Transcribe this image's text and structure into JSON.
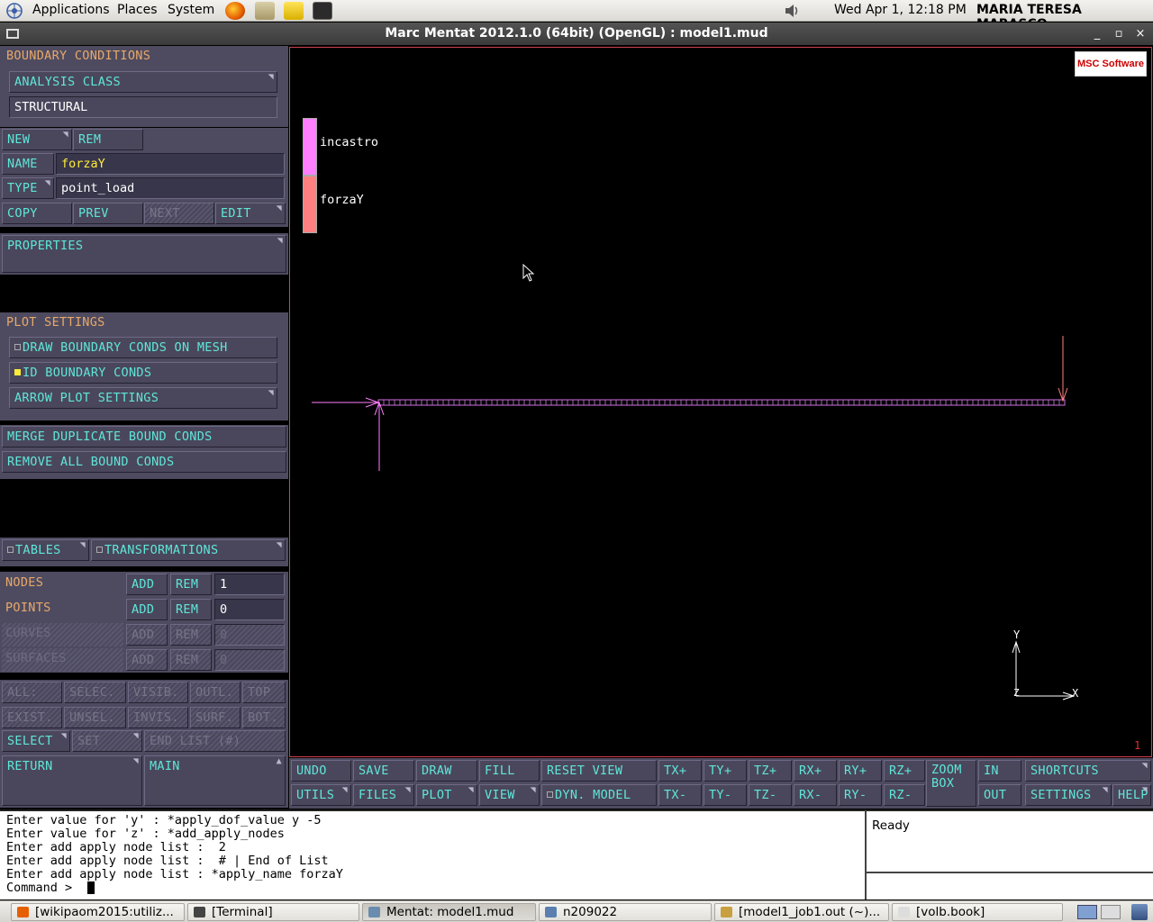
{
  "topbar": {
    "menus": [
      "Applications",
      "Places",
      "System"
    ],
    "datetime": "Wed Apr  1, 12:18 PM",
    "user": "MARIA TERESA MARASCO"
  },
  "window": {
    "title": "Marc Mentat 2012.1.0 (64bit) (OpenGL) : model1.mud"
  },
  "left": {
    "boundary_conditions": "BOUNDARY CONDITIONS",
    "analysis_class": "ANALYSIS CLASS",
    "structural": "STRUCTURAL",
    "new": "NEW",
    "rem": "REM",
    "name_label": "NAME",
    "name_value": "forzaY",
    "type_label": "TYPE",
    "type_value": "point_load",
    "copy": "COPY",
    "prev": "PREV",
    "next": "NEXT",
    "edit": "EDIT",
    "properties": "PROPERTIES",
    "plot_settings": "PLOT SETTINGS",
    "draw_bc": "DRAW BOUNDARY CONDS ON MESH",
    "id_bc": "ID BOUNDARY CONDS",
    "arrow_plot": "ARROW PLOT SETTINGS",
    "merge_dup": "MERGE DUPLICATE BOUND CONDS",
    "remove_all": "REMOVE ALL BOUND CONDS",
    "tables": "TABLES",
    "transformations": "TRANSFORMATIONS",
    "entities": [
      {
        "label": "NODES",
        "add": "ADD",
        "rem": "REM",
        "count": "1",
        "enabled": true
      },
      {
        "label": "POINTS",
        "add": "ADD",
        "rem": "REM",
        "count": "0",
        "enabled": true
      },
      {
        "label": "CURVES",
        "add": "ADD",
        "rem": "REM",
        "count": "0",
        "enabled": false
      },
      {
        "label": "SURFACES",
        "add": "ADD",
        "rem": "REM",
        "count": "0",
        "enabled": false
      }
    ],
    "sel_row1": [
      "ALL:",
      "SELEC.",
      "VISIB.",
      "OUTL.",
      "TOP"
    ],
    "sel_row2": [
      "EXIST.",
      "UNSEL.",
      "INVIS.",
      "SURF.",
      "BOT."
    ],
    "select": "SELECT",
    "set": "SET",
    "end_list": "END LIST (#)",
    "return": "RETURN",
    "main": "MAIN"
  },
  "viewport": {
    "logo": "MSC Software",
    "legend": [
      {
        "name": "incastro",
        "color": "#ff7fff"
      },
      {
        "name": "forzaY",
        "color": "#ff8080"
      }
    ],
    "axis_x": "X",
    "axis_y": "Y",
    "axis_z": "Z",
    "view_number": "1"
  },
  "toolbar": {
    "row1": [
      "UNDO",
      "SAVE",
      "DRAW",
      "FILL",
      "RESET VIEW",
      "TX+",
      "TY+",
      "TZ+",
      "RX+",
      "RY+",
      "RZ+"
    ],
    "row2": [
      "UTILS",
      "FILES",
      "PLOT",
      "VIEW",
      "DYN. MODEL",
      "TX-",
      "TY-",
      "TZ-",
      "RX-",
      "RY-",
      "RZ-"
    ],
    "zoom_box": "ZOOM BOX",
    "in": "IN",
    "out": "OUT",
    "shortcuts": "SHORTCUTS",
    "settings": "SETTINGS",
    "help": "HELP"
  },
  "console": {
    "lines": [
      "Enter value for 'y' : *apply_dof_value y -5",
      "Enter value for 'z' : *add_apply_nodes",
      "Enter add apply node list :  2",
      "Enter add apply node list :  # | End of List",
      "Enter add apply node list : *apply_name forzaY",
      "Command > "
    ],
    "status": "Ready"
  },
  "taskbar": {
    "items": [
      {
        "label": "[wikipaom2015:utiliz...",
        "color": "#e66000"
      },
      {
        "label": "[Terminal]",
        "color": "#444"
      },
      {
        "label": "Mentat: model1.mud",
        "color": "#6a8caf"
      },
      {
        "label": "n209022",
        "color": "#5a7fb0"
      },
      {
        "label": "[model1_job1.out (~)...",
        "color": "#c8a040"
      },
      {
        "label": "[volb.book]",
        "color": "#ddd"
      }
    ]
  }
}
